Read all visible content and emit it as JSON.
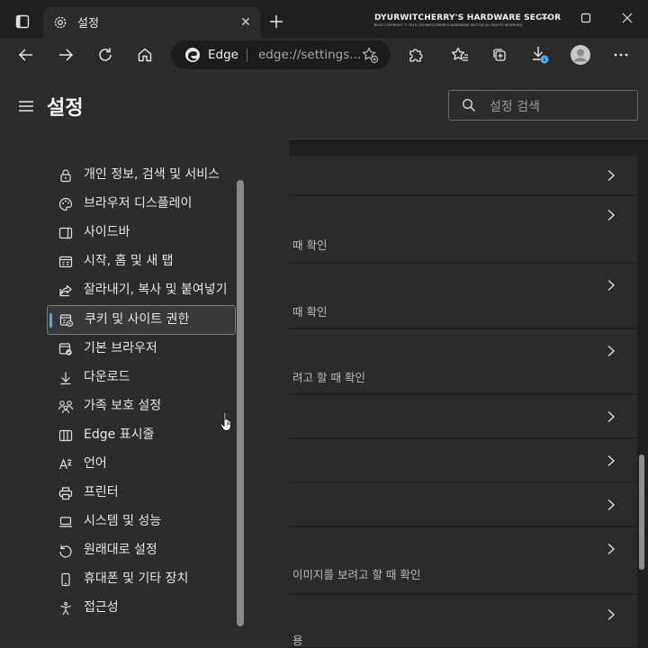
{
  "tab": {
    "title": "설정",
    "close": "✕"
  },
  "watermark": {
    "title": "DYURWITCHERRY'S HARDWARE SECTOR",
    "subtitle": "BLOG COPYRIGHT © 2019, DYURWITCHERRY'S HARDWARE SECTOR ALL RIGHTS RESERVED."
  },
  "address": {
    "site": "Edge",
    "url": "edge://settings..."
  },
  "settings": {
    "title": "설정",
    "search_placeholder": "설정 검색"
  },
  "sidebar": {
    "items": [
      {
        "label": "개인 정보, 검색 및 서비스",
        "icon": "lock-icon",
        "active": false
      },
      {
        "label": "브라우저 디스플레이",
        "icon": "palette-icon",
        "active": false
      },
      {
        "label": "사이드바",
        "icon": "sidebar-icon",
        "active": false
      },
      {
        "label": "시작, 홈 및 새 탭",
        "icon": "start-page-icon",
        "active": false
      },
      {
        "label": "잘라내기, 복사 및 붙여넣기",
        "icon": "share-icon",
        "active": false
      },
      {
        "label": "쿠키 및 사이트 권한",
        "icon": "site-permissions-icon",
        "active": true
      },
      {
        "label": "기본 브라우저",
        "icon": "default-browser-icon",
        "active": false
      },
      {
        "label": "다운로드",
        "icon": "download-icon",
        "active": false
      },
      {
        "label": "가족 보호 설정",
        "icon": "family-icon",
        "active": false
      },
      {
        "label": "Edge 표시줄",
        "icon": "edge-bar-icon",
        "active": false
      },
      {
        "label": "언어",
        "icon": "language-icon",
        "active": false
      },
      {
        "label": "프린터",
        "icon": "printer-icon",
        "active": false
      },
      {
        "label": "시스템 및 성능",
        "icon": "laptop-icon",
        "active": false
      },
      {
        "label": "원래대로 설정",
        "icon": "reset-icon",
        "active": false
      },
      {
        "label": "휴대폰 및 기타 장치",
        "icon": "phone-icon",
        "active": false
      },
      {
        "label": "접근성",
        "icon": "accessibility-icon",
        "active": false
      }
    ]
  },
  "content": {
    "rows": [
      {
        "sub": ""
      },
      {
        "sub": "때 확인"
      },
      {
        "sub": "때 확인"
      },
      {
        "sub": "려고 할 때 확인"
      },
      {
        "sub": ""
      },
      {
        "sub": ""
      },
      {
        "sub": ""
      },
      {
        "sub": "이미지를 보려고 할 때 확인"
      },
      {
        "sub": "용"
      }
    ]
  },
  "colors": {
    "accent": "#4aa8ff",
    "background": "#202020",
    "sidebar": "#2c2c2c",
    "card": "#2b2b2b"
  }
}
